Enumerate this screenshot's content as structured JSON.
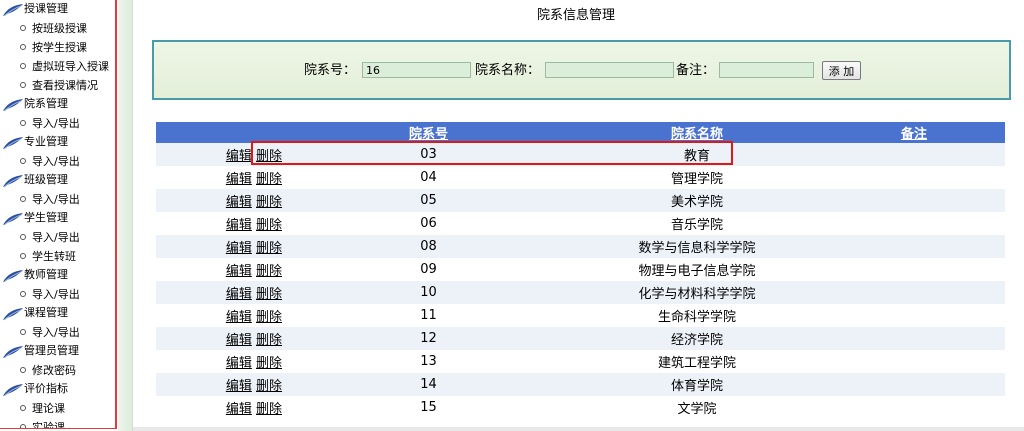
{
  "sidebar": {
    "groups": [
      {
        "label": "授课管理",
        "items": [
          "按班级授课",
          "按学生授课",
          "虚拟班导入授课",
          "查看授课情况"
        ]
      },
      {
        "label": "院系管理",
        "items": [
          "导入/导出"
        ]
      },
      {
        "label": "专业管理",
        "items": [
          "导入/导出"
        ]
      },
      {
        "label": "班级管理",
        "items": [
          "导入/导出"
        ]
      },
      {
        "label": "学生管理",
        "items": [
          "导入/导出",
          "学生转班"
        ]
      },
      {
        "label": "教师管理",
        "items": [
          "导入/导出"
        ]
      },
      {
        "label": "课程管理",
        "items": [
          "导入/导出"
        ]
      },
      {
        "label": "管理员管理",
        "items": [
          "修改密码"
        ]
      },
      {
        "label": "评价指标",
        "items": [
          "理论课",
          "实验课"
        ]
      }
    ]
  },
  "page": {
    "title": "院系信息管理"
  },
  "form": {
    "dept_id_label": "院系号：",
    "dept_id_value": "16",
    "dept_name_label": "院系名称：",
    "dept_name_value": "",
    "remark_label": "备注：",
    "remark_value": "",
    "add_label": "添 加"
  },
  "table": {
    "headers": [
      "",
      "院系号",
      "院系名称",
      "备注"
    ],
    "edit_label": "编辑",
    "delete_label": "删除",
    "rows": [
      {
        "id": "03",
        "name": "教育",
        "remark": ""
      },
      {
        "id": "04",
        "name": "管理学院",
        "remark": ""
      },
      {
        "id": "05",
        "name": "美术学院",
        "remark": ""
      },
      {
        "id": "06",
        "name": "音乐学院",
        "remark": ""
      },
      {
        "id": "08",
        "name": "数学与信息科学学院",
        "remark": ""
      },
      {
        "id": "09",
        "name": "物理与电子信息学院",
        "remark": ""
      },
      {
        "id": "10",
        "name": "化学与材料科学学院",
        "remark": ""
      },
      {
        "id": "11",
        "name": "生命科学学院",
        "remark": ""
      },
      {
        "id": "12",
        "name": "经济学院",
        "remark": ""
      },
      {
        "id": "13",
        "name": "建筑工程学院",
        "remark": ""
      },
      {
        "id": "14",
        "name": "体育学院",
        "remark": ""
      },
      {
        "id": "15",
        "name": "文学院",
        "remark": ""
      }
    ]
  },
  "colors": {
    "header_blue": "#4a73d0",
    "panel_border": "#4a9aa8",
    "highlight_red": "#e01818"
  }
}
